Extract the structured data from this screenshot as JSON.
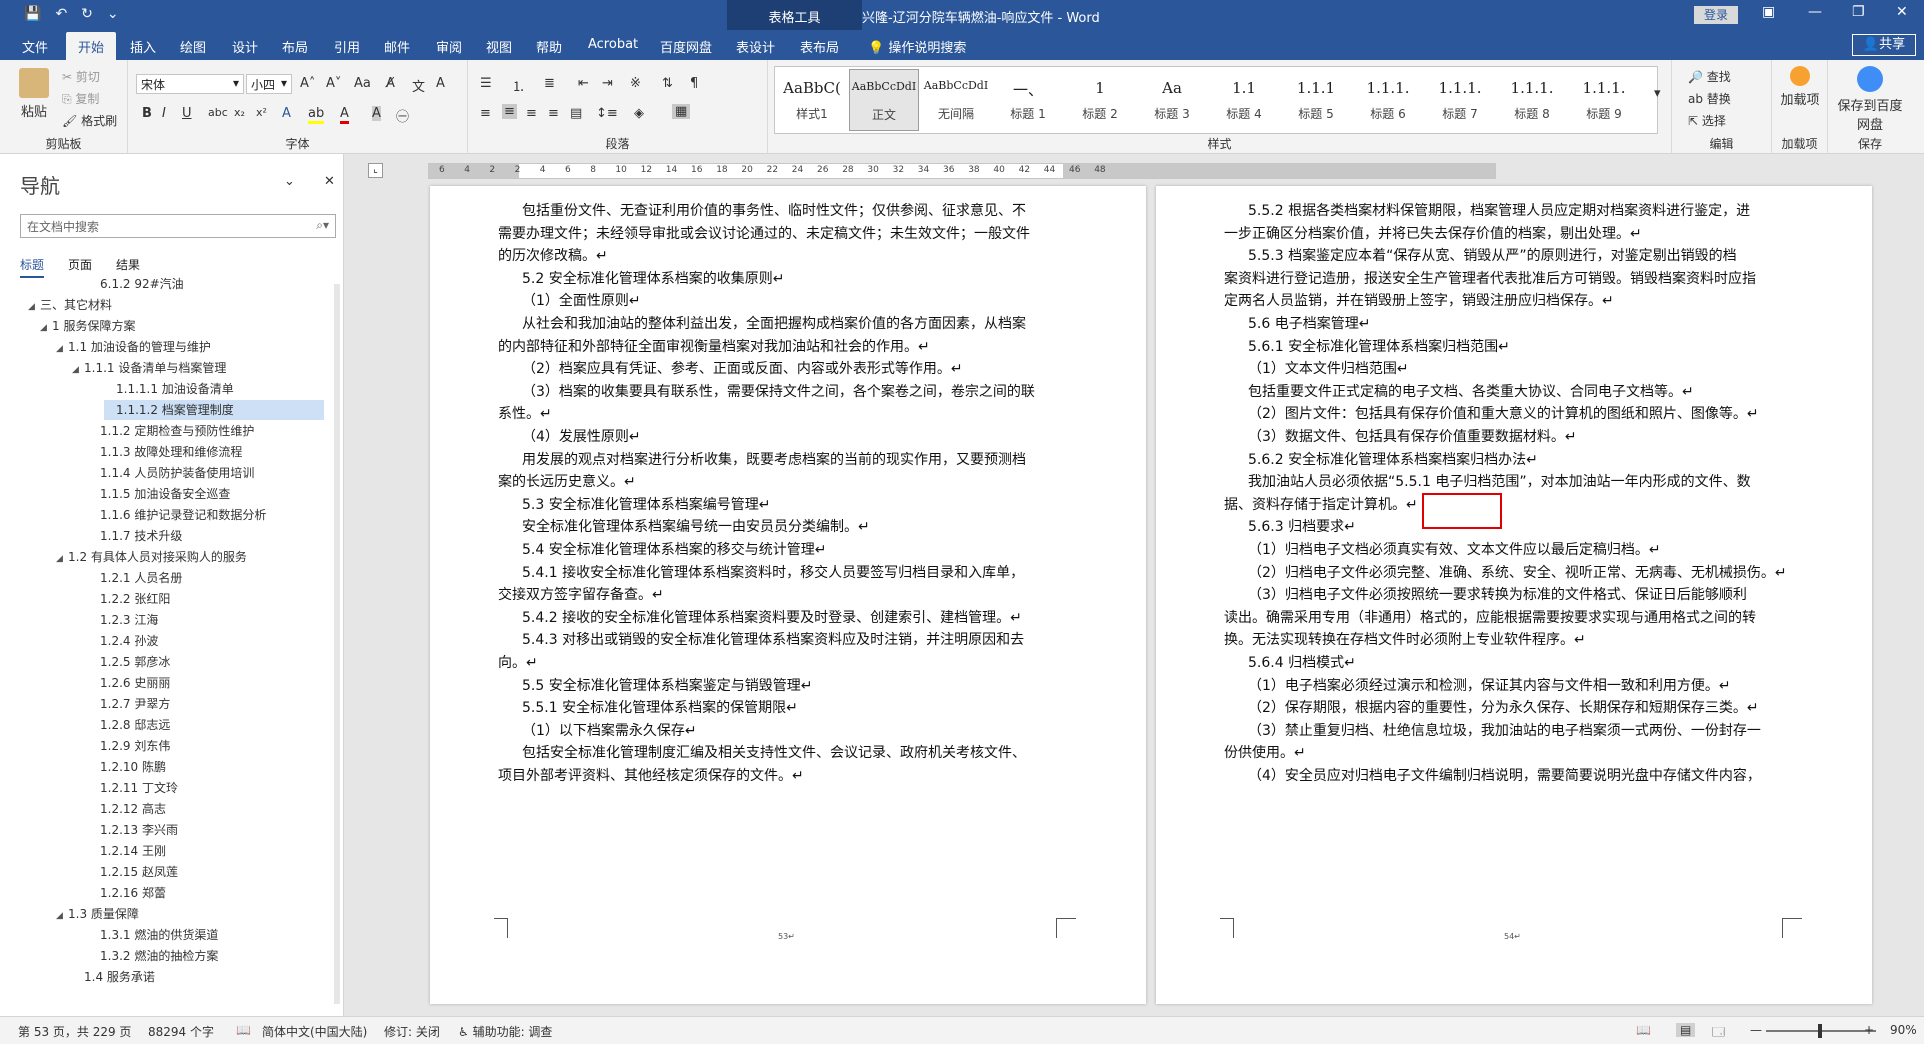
{
  "titlebar": {
    "table_tools": "表格工具",
    "doc_title": "兴隆-辽河分院车辆燃油-响应文件 - Word",
    "login": "登录"
  },
  "ribbon_tabs": [
    "文件",
    "开始",
    "插入",
    "绘图",
    "设计",
    "布局",
    "引用",
    "邮件",
    "审阅",
    "视图",
    "帮助",
    "Acrobat",
    "百度网盘",
    "表设计",
    "表布局"
  ],
  "tell_me": "操作说明搜索",
  "share": "共享",
  "ribbon": {
    "clipboard": {
      "paste": "粘贴",
      "cut": "剪切",
      "copy": "复制",
      "format_painter": "格式刷",
      "label": "剪贴板"
    },
    "font": {
      "name": "宋体",
      "size": "小四",
      "label": "字体"
    },
    "paragraph": {
      "label": "段落"
    },
    "styles": {
      "label": "样式",
      "items": [
        {
          "preview": "AaBbC(",
          "name": "样式1"
        },
        {
          "preview": "AaBbCcDdI",
          "name": "正文"
        },
        {
          "preview": "AaBbCcDdI",
          "name": "无间隔"
        },
        {
          "preview": "一、",
          "name": "标题 1"
        },
        {
          "preview": "1",
          "name": "标题 2"
        },
        {
          "preview": "Aa",
          "name": "标题 3"
        },
        {
          "preview": "1.1",
          "name": "标题 4"
        },
        {
          "preview": "1.1.1",
          "name": "标题 5"
        },
        {
          "preview": "1.1.1.",
          "name": "标题 6"
        },
        {
          "preview": "1.1.1.",
          "name": "标题 7"
        },
        {
          "preview": "1.1.1.",
          "name": "标题 8"
        },
        {
          "preview": "1.1.1.",
          "name": "标题 9"
        }
      ]
    },
    "editing": {
      "find": "查找",
      "replace": "替换",
      "select": "选择",
      "label": "编辑"
    },
    "addins": {
      "load": "加载项",
      "label": "加载项"
    },
    "save": {
      "save_to": "保存到百度网盘",
      "label": "保存"
    }
  },
  "nav": {
    "title": "导航",
    "search_placeholder": "在文档中搜索",
    "tabs": [
      "标题",
      "页面",
      "结果"
    ],
    "items": [
      {
        "text": "6.1.2 92#汽油",
        "tri": ""
      },
      {
        "text": "三、其它材料",
        "tri": "◢"
      },
      {
        "text": "1 服务保障方案",
        "tri": "◢"
      },
      {
        "text": "1.1 加油设备的管理与维护",
        "tri": "◢"
      },
      {
        "text": "1.1.1 设备清单与档案管理",
        "tri": "◢"
      },
      {
        "text": "1.1.1.1 加油设备清单",
        "tri": ""
      },
      {
        "text": "1.1.1.2 档案管理制度",
        "tri": ""
      },
      {
        "text": "1.1.2 定期检查与预防性维护",
        "tri": ""
      },
      {
        "text": "1.1.3 故障处理和维修流程",
        "tri": ""
      },
      {
        "text": "1.1.4 人员防护装备使用培训",
        "tri": ""
      },
      {
        "text": "1.1.5 加油设备安全巡查",
        "tri": ""
      },
      {
        "text": "1.1.6 维护记录登记和数据分析",
        "tri": ""
      },
      {
        "text": "1.1.7 技术升级",
        "tri": ""
      },
      {
        "text": "1.2 有具体人员对接采购人的服务",
        "tri": "◢"
      },
      {
        "text": "1.2.1 人员名册",
        "tri": ""
      },
      {
        "text": "1.2.2 张红阳",
        "tri": ""
      },
      {
        "text": "1.2.3 江海",
        "tri": ""
      },
      {
        "text": "1.2.4 孙波",
        "tri": ""
      },
      {
        "text": "1.2.5 郭彦冰",
        "tri": ""
      },
      {
        "text": "1.2.6 史丽丽",
        "tri": ""
      },
      {
        "text": "1.2.7 尹翠方",
        "tri": ""
      },
      {
        "text": "1.2.8 邸志远",
        "tri": ""
      },
      {
        "text": "1.2.9 刘东伟",
        "tri": ""
      },
      {
        "text": "1.2.10 陈鹏",
        "tri": ""
      },
      {
        "text": "1.2.11 丁文玲",
        "tri": ""
      },
      {
        "text": "1.2.12 高志",
        "tri": ""
      },
      {
        "text": "1.2.13 李兴雨",
        "tri": ""
      },
      {
        "text": "1.2.14 王刚",
        "tri": ""
      },
      {
        "text": "1.2.15 赵凤莲",
        "tri": ""
      },
      {
        "text": "1.2.16 郑蕾",
        "tri": ""
      },
      {
        "text": "1.3 质量保障",
        "tri": "◢"
      },
      {
        "text": "1.3.1 燃油的供货渠道",
        "tri": ""
      },
      {
        "text": "1.3.2 燃油的抽检方案",
        "tri": ""
      },
      {
        "text": "1.4 服务承诺",
        "tri": ""
      }
    ]
  },
  "ruler_ticks": [
    "6",
    "4",
    "2",
    "2",
    "4",
    "6",
    "8",
    "10",
    "12",
    "14",
    "16",
    "18",
    "20",
    "22",
    "24",
    "26",
    "28",
    "30",
    "32",
    "34",
    "36",
    "38",
    "40",
    "42",
    "44",
    "46",
    "48"
  ],
  "page_left": {
    "lines": [
      "包括重份文件、无查证利用价值的事务性、临时性文件；仅供参阅、征求意见、不",
      "需要办理文件；未经领导审批或会议讨论通过的、未定稿文件；未生效文件；一般文件",
      "的历次修改稿。↵",
      "5.2 安全标准化管理体系档案的收集原则↵",
      "（1）全面性原则↵",
      "从社会和我加油站的整体利益出发，全面把握构成档案价值的各方面因素，从档案",
      "的内部特征和外部特征全面审视衡量档案对我加油站和社会的作用。↵",
      "（2）档案应具有凭证、参考、正面或反面、内容或外表形式等作用。↵",
      "（3）档案的收集要具有联系性，需要保持文件之间，各个案卷之间，卷宗之间的联",
      "系性。↵",
      "（4）发展性原则↵",
      "用发展的观点对档案进行分析收集，既要考虑档案的当前的现实作用，又要预测档",
      "案的长远历史意义。↵",
      "5.3 安全标准化管理体系档案编号管理↵",
      "安全标准化管理体系档案编号统一由安员员分类编制。↵",
      "5.4 安全标准化管理体系档案的移交与统计管理↵",
      "5.4.1 接收安全标准化管理体系档案资料时，移交人员要签写归档目录和入库单，",
      "交接双方签字留存备查。↵",
      "5.4.2 接收的安全标准化管理体系档案资料要及时登录、创建索引、建档管理。↵",
      "5.4.3 对移出或销毁的安全标准化管理体系档案资料应及时注销，并注明原因和去",
      "向。↵",
      "5.5 安全标准化管理体系档案鉴定与销毁管理↵",
      "5.5.1 安全标准化管理体系档案的保管期限↵",
      "（1）以下档案需永久保存↵",
      "包括安全标准化管理制度汇编及相关支持性文件、会议记录、政府机关考核文件、",
      "项目外部考评资料、其他经核定须保存的文件。↵"
    ],
    "page_num": "53↵"
  },
  "page_right": {
    "lines": [
      "5.5.2 根据各类档案材料保管期限，档案管理人员应定期对档案资料进行鉴定，进",
      "一步正确区分档案价值，并将已失去保存价值的档案，剔出处理。↵",
      "5.5.3 档案鉴定应本着“保存从宽、销毁从严”的原则进行，对鉴定剔出销毁的档",
      "案资料进行登记造册，报送安全生产管理者代表批准后方可销毁。销毁档案资料时应指",
      "定两名人员监销，并在销毁册上签字，销毁注册应归档保存。↵",
      "5.6 电子档案管理↵",
      "5.6.1 安全标准化管理体系档案归档范围↵",
      "（1）文本文件归档范围↵",
      "包括重要文件正式定稿的电子文档、各类重大协议、合同电子文档等。↵",
      "（2）图片文件：包括具有保存价值和重大意义的计算机的图纸和照片、图像等。↵",
      "（3）数据文件、包括具有保存价值重要数据材料。↵",
      "5.6.2 安全标准化管理体系档案档案归档办法↵",
      "我加油站人员必须依据“5.5.1 电子归档范围”，对本加油站一年内形成的文件、数",
      "据、资料存储于指定计算机。↵",
      "5.6.3 归档要求↵",
      "（1）归档电子文档必须真实有效、文本文件应以最后定稿归档。↵",
      "（2）归档电子文件必须完整、准确、系统、安全、视听正常、无病毒、无机械损伤。↵",
      "（3）归档电子文件必须按照统一要求转换为标准的文件格式、保证日后能够顺利",
      "读出。确需采用专用（非通用）格式的，应能根据需要按要求实现与通用格式之间的转",
      "换。无法实现转换在存档文件时必须附上专业软件程序。↵",
      "5.6.4 归档模式↵",
      "（1）电子档案必须经过演示和检测，保证其内容与文件相一致和利用方便。↵",
      "（2）保存期限，根据内容的重要性，分为永久保存、长期保存和短期保存三类。↵",
      "（3）禁止重复归档、杜绝信息垃圾，我加油站的电子档案须一式两份、一份封存一",
      "份供使用。↵",
      "（4）安全员应对归档电子文件编制归档说明，需要简要说明光盘中存储文件内容，"
    ],
    "page_num": "54↵"
  },
  "status": {
    "page": "第 53 页，共 229 页",
    "words": "88294 个字",
    "language": "简体中文(中国大陆)",
    "track": "修订: 关闭",
    "accessibility": "辅助功能: 调查",
    "zoom": "90%"
  }
}
